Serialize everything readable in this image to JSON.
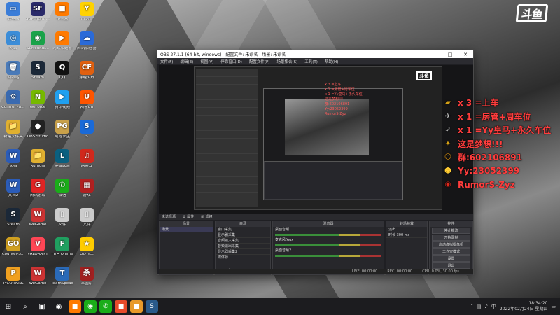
{
  "desktop": {
    "icons": [
      {
        "label": "此电脑",
        "glyph": "▭",
        "color": "#3b7dd8"
      },
      {
        "label": "SGP(Fight Cl...",
        "glyph": "SF",
        "color": "#2a2a6a"
      },
      {
        "label": "小黑盒",
        "glyph": "■",
        "color": "#ff7a00"
      },
      {
        "label": "YY语音",
        "glyph": "Y",
        "color": "#ffd200"
      },
      {
        "label": "网络",
        "glyph": "◎",
        "color": "#3c8dd8"
      },
      {
        "label": "Surroundi...",
        "glyph": "◉",
        "color": "#1aa34a"
      },
      {
        "label": "网易加速器",
        "glyph": "▶",
        "color": "#ff7a00"
      },
      {
        "label": "腾讯加速器",
        "glyph": "☁",
        "color": "#2a6ad8"
      },
      {
        "label": "回收站",
        "glyph": "🗑",
        "color": "#4a7ab8"
      },
      {
        "label": "Steam",
        "glyph": "S",
        "color": "#1b2838"
      },
      {
        "label": "QQ",
        "glyph": "Q",
        "color": "#111"
      },
      {
        "label": "穿越火线",
        "glyph": "CF",
        "color": "#e06010"
      },
      {
        "label": "Control Panel",
        "glyph": "⚙",
        "color": "#3a6ab0"
      },
      {
        "label": "GeForce",
        "glyph": "N",
        "color": "#76b900"
      },
      {
        "label": "腾讯视频",
        "glyph": "▶",
        "color": "#20a0f0"
      },
      {
        "label": "网易UU",
        "glyph": "U",
        "color": "#ff5500"
      },
      {
        "label": "新建文件夹",
        "glyph": "📁",
        "color": "#e0b030"
      },
      {
        "label": "OBS Studio",
        "glyph": "●",
        "color": "#222"
      },
      {
        "label": "绝地求生",
        "glyph": "PG",
        "color": "#c9a14a"
      },
      {
        "label": "S",
        "glyph": "S",
        "color": "#1a6ad8"
      },
      {
        "label": "文档",
        "glyph": "W",
        "color": "#2b5cb8"
      },
      {
        "label": "Rumors",
        "glyph": "📁",
        "color": "#e0b030"
      },
      {
        "label": "英雄联盟",
        "glyph": "L",
        "color": "#0a6080"
      },
      {
        "label": "网易云",
        "glyph": "♫",
        "color": "#d0281c"
      },
      {
        "label": "文档2",
        "glyph": "W",
        "color": "#2b5cb8"
      },
      {
        "label": "腾讯游戏",
        "glyph": "G",
        "color": "#e02424"
      },
      {
        "label": "微信",
        "glyph": "✆",
        "color": "#1aad19"
      },
      {
        "label": "游戏",
        "glyph": "▦",
        "color": "#b02020"
      },
      {
        "label": "Steam",
        "glyph": "S",
        "color": "#1b2838"
      },
      {
        "label": "WeGame",
        "glyph": "W",
        "color": "#c33"
      },
      {
        "label": "文件",
        "glyph": "▯",
        "color": "#ccc"
      },
      {
        "label": "文件",
        "glyph": "▯",
        "color": "#ccc"
      },
      {
        "label": "Counter-S...",
        "glyph": "GO",
        "color": "#d0a020"
      },
      {
        "label": "VALORANT",
        "glyph": "V",
        "color": "#ff4655"
      },
      {
        "label": "FIFA Online",
        "glyph": "F",
        "color": "#20a060"
      },
      {
        "label": "QQ飞车",
        "glyph": "★",
        "color": "#ffcc00"
      },
      {
        "label": "PICO PARK",
        "glyph": "P",
        "color": "#f0a020"
      },
      {
        "label": "WeGame",
        "glyph": "W",
        "color": "#c33"
      },
      {
        "label": "TeamSpeak",
        "glyph": "T",
        "color": "#2a6ab8"
      },
      {
        "label": "三国杀",
        "glyph": "杀",
        "color": "#a02020"
      }
    ]
  },
  "logo": {
    "text": "斗鱼"
  },
  "obs": {
    "title": "OBS 27.1.1 (64-bit, windows) - 配置文件: 未命名 - 场景: 未命名",
    "menu": [
      "文件(F)",
      "编辑(E)",
      "视图(V)",
      "停靠窗口(D)",
      "配置文件(P)",
      "场景集合(S)",
      "工具(T)",
      "帮助(H)"
    ],
    "active_source": "未选择源",
    "scene_bar": [
      "⚙ 属性",
      "▥ 滤镜"
    ],
    "docks": {
      "scenes": {
        "title": "场景",
        "items": [
          "场景"
        ]
      },
      "sources": {
        "title": "来源",
        "items": [
          "窗口采集",
          "显示器采集",
          "音频输入采集",
          "音频输出采集",
          "显示器采集2",
          "媒体源"
        ]
      },
      "mixer": {
        "title": "混音器",
        "tracks": [
          "桌面音频",
          "麦克风/Aux",
          "桌面音频2"
        ]
      },
      "transitions": {
        "title": "转场特效",
        "type": "淡出",
        "duration_label": "时长",
        "duration": "300 ms"
      },
      "controls": {
        "title": "控件",
        "buttons": [
          "停止推流",
          "开始录制",
          "启动虚拟摄像机",
          "工作室模式",
          "设置",
          "退出"
        ]
      }
    },
    "status": [
      "LIVE: 00:00:00",
      "REC: 00:00:00",
      "CPU: 0.0%, 30.00 fps"
    ]
  },
  "overlay_ranks": [
    {
      "icon": "gold-bar-icon",
      "text": "x 3 =上车",
      "color": "#d4a017"
    },
    {
      "icon": "airplane-icon",
      "text": "x 1 =房管+周车位",
      "color": "#bbb"
    },
    {
      "icon": "rocket-icon",
      "text": "x 1 =Yy皇马+永久车位",
      "color": "#bbb"
    },
    {
      "icon": "medal-icon",
      "text": "这是梦想!!!",
      "color": "#d4a017"
    },
    {
      "icon": "group-icon",
      "text": "群:602106891",
      "color": "#d49017"
    },
    {
      "icon": "yy-icon",
      "text": "Yy:23052399",
      "color": "#ffcc33"
    },
    {
      "icon": "weibo-icon",
      "text": "RumorS-Zyz",
      "color": "#e0281c"
    }
  ],
  "taskbar": {
    "apps": [
      {
        "glyph": "■",
        "color": "#ff7a00"
      },
      {
        "glyph": "◉",
        "color": "#1aad19"
      },
      {
        "glyph": "✆",
        "color": "#1aad19"
      },
      {
        "glyph": "■",
        "color": "#e84a2a"
      },
      {
        "glyph": "■",
        "color": "#e89a2a"
      },
      {
        "glyph": "S",
        "color": "#2a5a8a"
      }
    ],
    "time": "18:34:20",
    "date": "2022年02月24日 星期四",
    "lang": "中"
  }
}
